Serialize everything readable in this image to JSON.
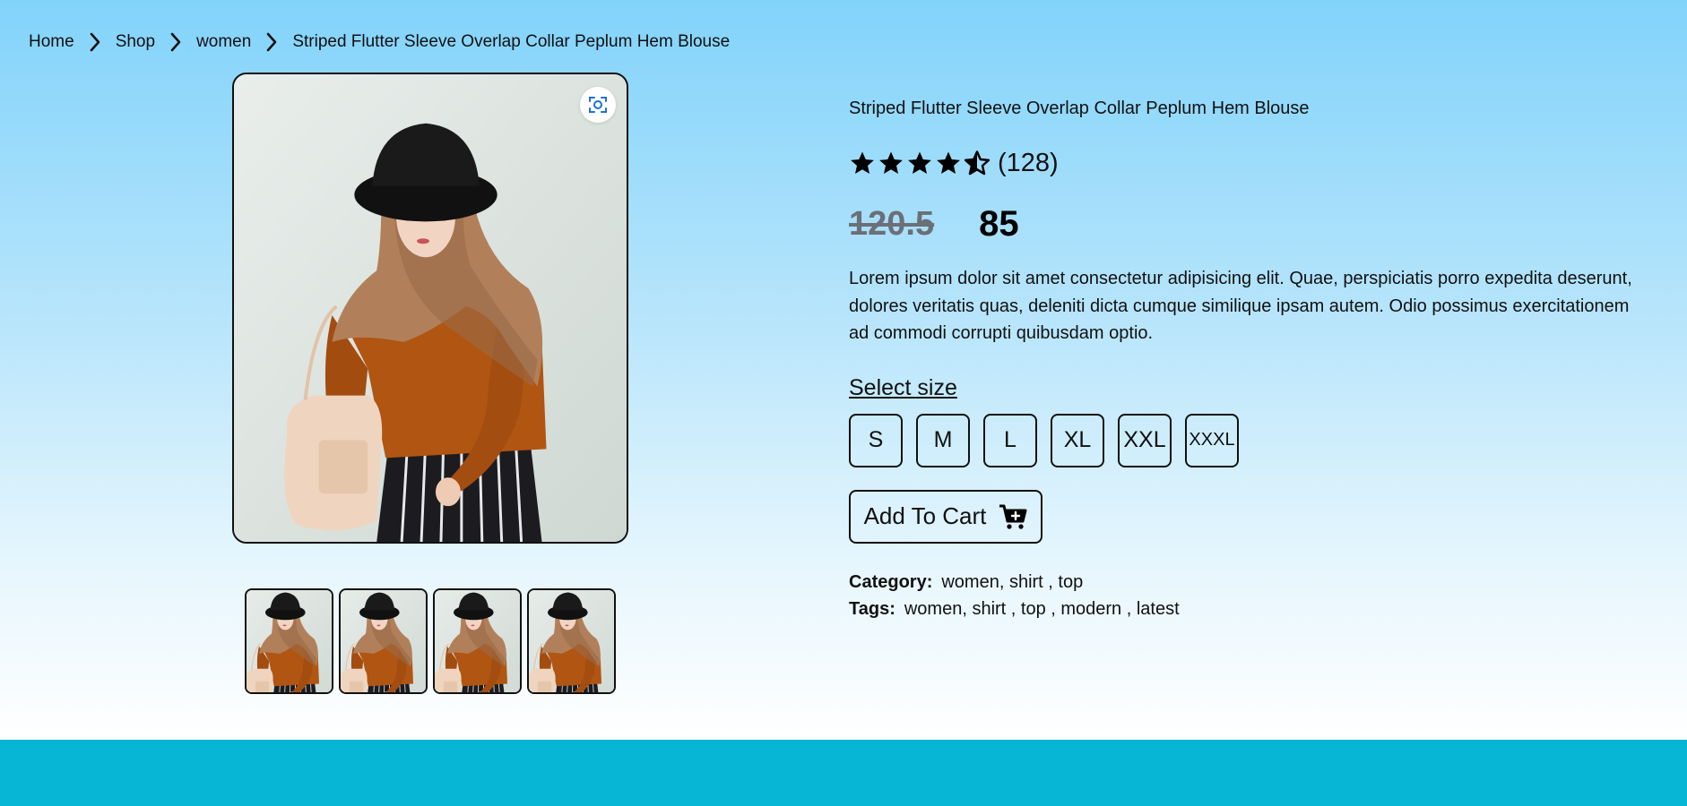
{
  "breadcrumb": {
    "items": [
      "Home",
      "Shop",
      "women"
    ],
    "current": "Striped Flutter Sleeve Overlap Collar Peplum Hem Blouse"
  },
  "product": {
    "title": "Striped Flutter Sleeve Overlap Collar Peplum Hem Blouse",
    "rating": 4.5,
    "rating_count": "(128)",
    "old_price": "120.5",
    "new_price": "85",
    "description": "Lorem ipsum dolor sit amet consectetur adipisicing elit. Quae, perspiciatis porro expedita deserunt, dolores veritatis quas, deleniti dicta cumque similique ipsam autem. Odio possimus exercitationem ad commodi corrupti quibusdam optio.",
    "size_heading": "Select size",
    "sizes": [
      "S",
      "M",
      "L",
      "XL",
      "XXL",
      "XXXL"
    ],
    "add_to_cart": "Add To Cart",
    "category_label": "Category:",
    "category_value": "women, shirt , top",
    "tags_label": "Tags:",
    "tags_value": "women, shirt , top , modern , latest"
  },
  "icons": {
    "chevron": "chevron-right-icon",
    "zoom": "zoom-scan-icon",
    "cart": "cart-add-icon",
    "star": "star-icon"
  },
  "colors": {
    "footer": "#06b6d4",
    "zoom_icon": "#1e6fd9",
    "old_price": "#6b6f78"
  }
}
